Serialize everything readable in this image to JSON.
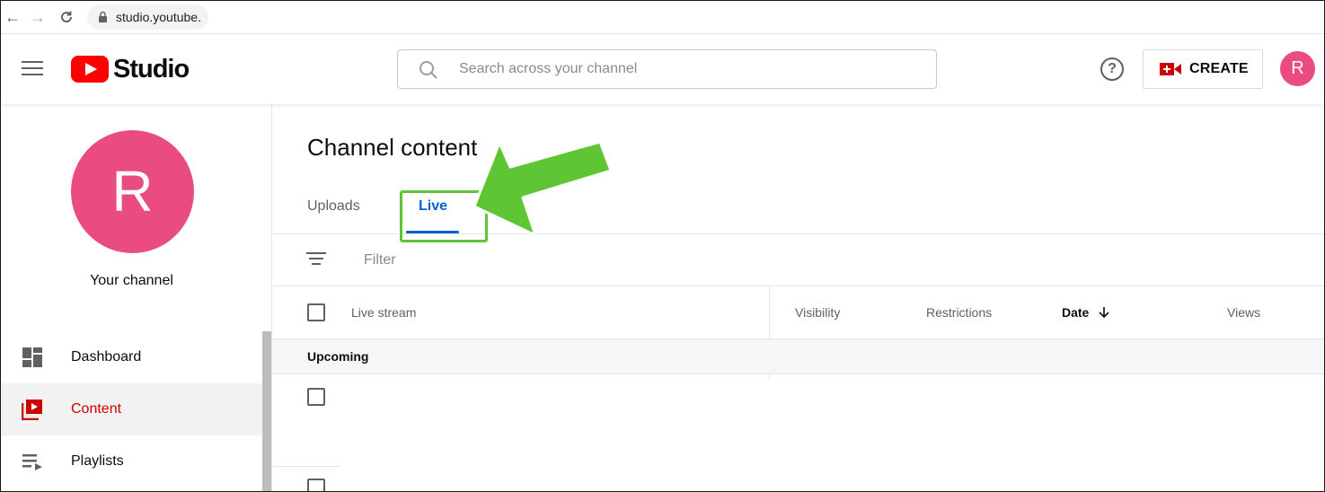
{
  "browser": {
    "url": "studio.youtube."
  },
  "header": {
    "logo_text": "Studio",
    "search_placeholder": "Search across your channel",
    "help_symbol": "?",
    "create_label": "CREATE",
    "avatar_initial": "R"
  },
  "sidebar": {
    "avatar_initial": "R",
    "channel_label": "Your channel",
    "items": [
      {
        "label": "Dashboard",
        "icon": "dashboard-icon",
        "active": false
      },
      {
        "label": "Content",
        "icon": "content-icon",
        "active": true
      },
      {
        "label": "Playlists",
        "icon": "playlists-icon",
        "active": false
      }
    ]
  },
  "main": {
    "title": "Channel content",
    "tabs": [
      {
        "label": "Uploads",
        "active": false
      },
      {
        "label": "Live",
        "active": true
      }
    ],
    "filter_label": "Filter",
    "columns": {
      "live_stream": "Live stream",
      "visibility": "Visibility",
      "restrictions": "Restrictions",
      "date": "Date",
      "views": "Views"
    },
    "group_label": "Upcoming"
  },
  "colors": {
    "brand_red": "#ff0000",
    "active_red": "#cc0000",
    "tab_blue": "#065fd4",
    "avatar_pink": "#ea4c7f",
    "annotation_green": "#5ec634"
  }
}
